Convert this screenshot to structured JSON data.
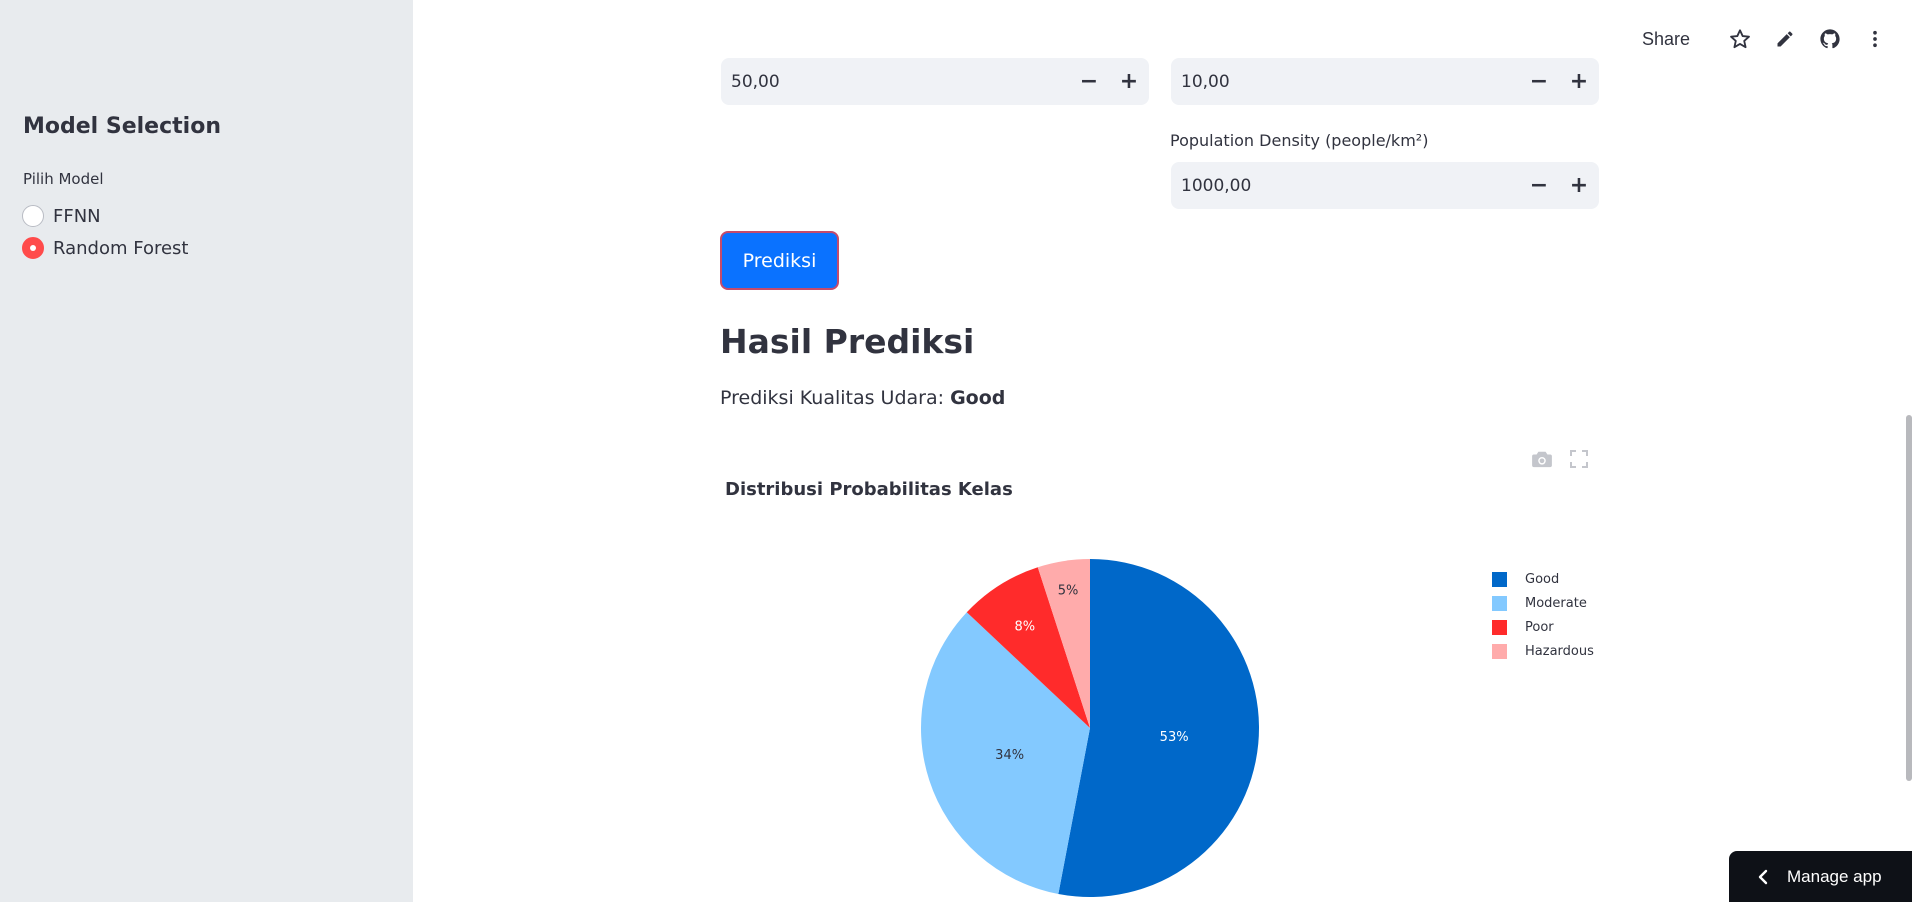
{
  "header": {
    "share_label": "Share",
    "icons": [
      "star-icon",
      "pencil-icon",
      "github-icon",
      "more-vertical-icon"
    ]
  },
  "sidebar": {
    "title": "Model Selection",
    "radio_label": "Pilih Model",
    "options": [
      {
        "label": "FFNN",
        "selected": false
      },
      {
        "label": "Random Forest",
        "selected": true
      }
    ]
  },
  "inputs": {
    "field_left_value": "50,00",
    "field_right_value": "10,00",
    "population_label": "Population Density (people/km²)",
    "population_value": "1000,00",
    "minus": "−",
    "plus": "+"
  },
  "predict_button": "Prediksi",
  "result": {
    "title": "Hasil Prediksi",
    "prefix": "Prediksi Kualitas Udara: ",
    "value": "Good"
  },
  "chart_data": {
    "type": "pie",
    "title": "Distribusi Probabilitas Kelas",
    "categories": [
      "Good",
      "Moderate",
      "Poor",
      "Hazardous"
    ],
    "values": [
      53,
      34,
      8,
      5
    ],
    "labels": [
      "53%",
      "34%",
      "8%",
      "5%"
    ],
    "colors": [
      "#0068c9",
      "#83c9ff",
      "#ff2b2b",
      "#ffabab"
    ],
    "label_colors": [
      "#ffffff",
      "#31333f",
      "#ffffff",
      "#31333f"
    ],
    "legend_position": "right"
  },
  "manage_app": "Manage app",
  "colors": {
    "sidebar_bg": "#e8ebee",
    "accent_radio": "#ff4b4b",
    "primary_button": "#0a72ff",
    "input_bg": "#f0f2f6"
  }
}
